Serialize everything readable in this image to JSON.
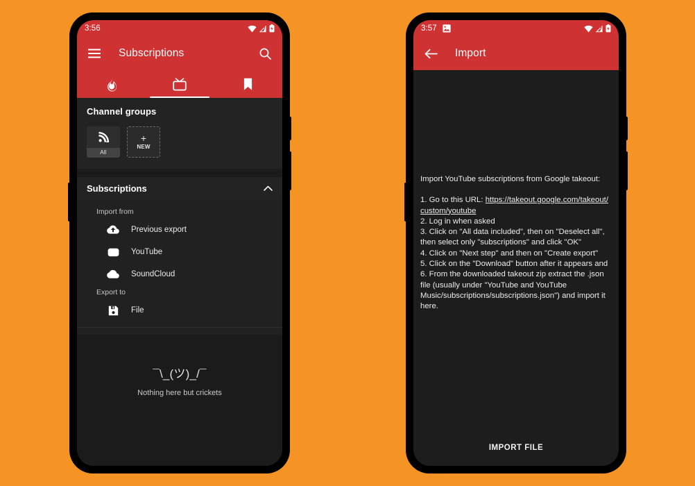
{
  "theme": {
    "page_background": "#F59425",
    "app_bar": "#CF3232",
    "surface_dark": "#1b1b1b",
    "surface_raised": "#232323",
    "text_primary": "#ffffff"
  },
  "left_phone": {
    "status_bar": {
      "time": "3:56",
      "icons": [
        "wifi-icon",
        "cell-signal-icon",
        "battery-icon"
      ]
    },
    "app_bar": {
      "menu_icon": "hamburger-menu-icon",
      "title": "Subscriptions",
      "search_icon": "search-icon"
    },
    "tabs": [
      {
        "name": "trending",
        "icon": "flame-icon",
        "active": false
      },
      {
        "name": "subscriptions",
        "icon": "tv-icon",
        "active": true
      },
      {
        "name": "bookmarks",
        "icon": "bookmark-icon",
        "active": false
      }
    ],
    "channel_groups": {
      "title": "Channel groups",
      "chips": [
        {
          "label": "All",
          "icon": "rss-icon",
          "style": "filled"
        },
        {
          "label": "NEW",
          "icon": "plus-icon",
          "style": "dashed"
        }
      ]
    },
    "subscriptions_section": {
      "title": "Subscriptions",
      "chevron": "chevron-up-icon",
      "groups": [
        {
          "caption": "Import from",
          "items": [
            {
              "label": "Previous export",
              "icon": "cloud-upload-icon"
            },
            {
              "label": "YouTube",
              "icon": "youtube-icon"
            },
            {
              "label": "SoundCloud",
              "icon": "cloud-icon"
            }
          ]
        },
        {
          "caption": "Export to",
          "items": [
            {
              "label": "File",
              "icon": "save-disk-icon"
            }
          ]
        }
      ]
    },
    "empty_state": {
      "art": "¯\\_(ツ)_/¯",
      "message": "Nothing here but crickets"
    }
  },
  "right_phone": {
    "status_bar": {
      "time": "3:57",
      "notification_icons": [
        "screenshot-image-icon"
      ],
      "icons": [
        "wifi-icon",
        "cell-signal-icon",
        "battery-icon"
      ]
    },
    "app_bar": {
      "back_icon": "arrow-back-icon",
      "title": "Import"
    },
    "content": {
      "intro": "Import YouTube subscriptions from Google takeout:",
      "step1_prefix": "1. Go to this URL: ",
      "url": "https://takeout.google.com/takeout/custom/youtube",
      "steps_rest": "2. Log in when asked\n3. Click on \"All data included\", then on \"Deselect all\", then select only \"subscriptions\" and click \"OK\"\n4. Click on \"Next step\" and then on \"Create export\"\n5. Click on the \"Download\" button after it appears and\n6. From the downloaded takeout zip extract the .json file (usually under \"YouTube and YouTube Music/subscriptions/subscriptions.json\") and import it here.",
      "import_button": "IMPORT FILE"
    }
  }
}
